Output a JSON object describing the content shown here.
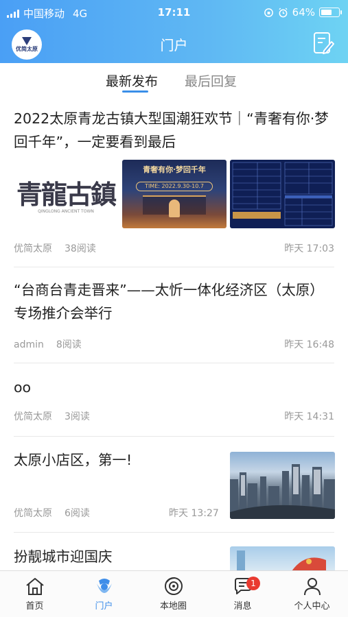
{
  "status_bar": {
    "carrier": "中国移动",
    "network": "4G",
    "time": "17:11",
    "battery": "64%",
    "battery_level": 0.64
  },
  "header": {
    "logo_text": "优简太原",
    "title": "门户"
  },
  "tabs": [
    {
      "label": "最新发布",
      "active": true
    },
    {
      "label": "最后回复",
      "active": false
    }
  ],
  "posts": [
    {
      "title": "2022太原青龙古镇大型国潮狂欢节｜“青奢有你·梦回千年”，一定要看到最后",
      "author": "优简太原",
      "reads": "38阅读",
      "time": "昨天 17:03",
      "image_text": "青龍古鎮",
      "image_sub": "QINGLONG ANCIENT TOWN",
      "poster_text": "青奢有你·梦回千年",
      "poster_date": "TIME: 2022.9.30-10.7"
    },
    {
      "title": "“台商台青走晋来”——太忻一体化经济区（太原）专场推介会举行",
      "author": "admin",
      "reads": "8阅读",
      "time": "昨天 16:48"
    },
    {
      "title": "oo",
      "author": "优简太原",
      "reads": "3阅读",
      "time": "昨天 14:31"
    },
    {
      "title": "太原小店区，第一!",
      "author": "优简太原",
      "reads": "6阅读",
      "time": "昨天 13:27"
    },
    {
      "title": "扮靓城市迎国庆"
    }
  ],
  "tabbar": [
    {
      "label": "首页",
      "icon": "home-icon"
    },
    {
      "label": "门户",
      "icon": "portal-icon",
      "active": true
    },
    {
      "label": "本地圈",
      "icon": "local-circle-icon"
    },
    {
      "label": "消息",
      "icon": "message-icon",
      "badge": "1"
    },
    {
      "label": "个人中心",
      "icon": "profile-icon"
    }
  ],
  "colors": {
    "accent": "#3f8ee9",
    "header_gradient_start": "#4a9ff5",
    "header_gradient_end": "#6ed3f3",
    "badge": "#e93a2f"
  }
}
